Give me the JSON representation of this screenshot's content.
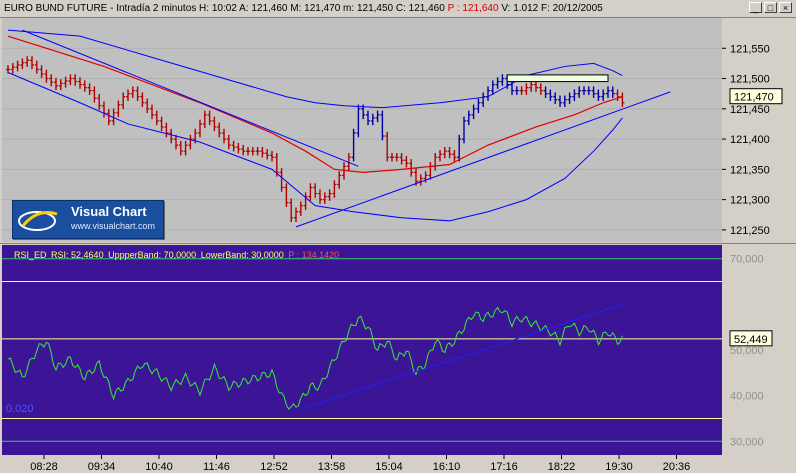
{
  "window": {
    "title": "EURO BUND FUTURE - Intradía 2 minutos",
    "high": "H: 10:02",
    "ohlc": "A: 121,460  M: 121,470  m: 121,450  C: 121,460",
    "p_value": "P : 121,640",
    "volume": "V: 1.012",
    "date": "F: 20/12/2005",
    "btn_minimize": "_",
    "btn_maximize": "□",
    "btn_close": "×"
  },
  "logo": {
    "title": "Visual Chart",
    "url": "www.visualchart.com"
  },
  "rsi_panel": {
    "header": [
      "RSI_ED",
      "RSI: 52,4640",
      "UppperBand: 70,0000",
      "LowerBand: 30,0000"
    ],
    "p_value": "P : 134,1420",
    "left_label": "0,020"
  },
  "colors": {
    "price_bg": "#c0c0c0",
    "rsi_bg": "#3c1496",
    "bar_red": "#b00000",
    "bar_blue": "#0000a0",
    "ma_line": "#e00000",
    "bands": "#0000ff",
    "rsi_line": "#33ee33",
    "guide_yellow": "#ffff99",
    "guide_green": "#33cc66"
  },
  "chart_data": [
    {
      "type": "ohlc",
      "title": "EURO BUND FUTURE",
      "x_ticks": [
        "08:28",
        "09:34",
        "10:40",
        "11:46",
        "12:52",
        "13:58",
        "15:04",
        "16:10",
        "17:16",
        "18:22",
        "19:30",
        "20:36"
      ],
      "y_ticks": [
        "121,550",
        "121,500",
        "121,450",
        "121,400",
        "121,350",
        "121,300",
        "121,250"
      ],
      "ylim": [
        121.23,
        121.6
      ],
      "last_value": "121,470",
      "close_series": [
        {
          "t": 0,
          "v": 121.515
        },
        {
          "t": 4,
          "v": 121.53
        },
        {
          "t": 8,
          "v": 121.5
        },
        {
          "t": 10,
          "v": 121.488
        },
        {
          "t": 13,
          "v": 121.5
        },
        {
          "t": 17,
          "v": 121.48
        },
        {
          "t": 19,
          "v": 121.455
        },
        {
          "t": 21,
          "v": 121.43
        },
        {
          "t": 24,
          "v": 121.47
        },
        {
          "t": 26,
          "v": 121.48
        },
        {
          "t": 28,
          "v": 121.46
        },
        {
          "t": 31,
          "v": 121.43
        },
        {
          "t": 34,
          "v": 121.4
        },
        {
          "t": 36,
          "v": 121.38
        },
        {
          "t": 39,
          "v": 121.41
        },
        {
          "t": 41,
          "v": 121.44
        },
        {
          "t": 43,
          "v": 121.42
        },
        {
          "t": 46,
          "v": 121.39
        },
        {
          "t": 49,
          "v": 121.38
        },
        {
          "t": 52,
          "v": 121.38
        },
        {
          "t": 55,
          "v": 121.37
        },
        {
          "t": 57,
          "v": 121.32
        },
        {
          "t": 59,
          "v": 121.27
        },
        {
          "t": 61,
          "v": 121.29
        },
        {
          "t": 63,
          "v": 121.32
        },
        {
          "t": 65,
          "v": 121.3
        },
        {
          "t": 67,
          "v": 121.31
        },
        {
          "t": 69,
          "v": 121.34
        },
        {
          "t": 71,
          "v": 121.37
        },
        {
          "t": 73,
          "v": 121.45
        },
        {
          "t": 75,
          "v": 121.43
        },
        {
          "t": 77,
          "v": 121.44
        },
        {
          "t": 79,
          "v": 121.37
        },
        {
          "t": 81,
          "v": 121.37
        },
        {
          "t": 83,
          "v": 121.36
        },
        {
          "t": 85,
          "v": 121.33
        },
        {
          "t": 87,
          "v": 121.34
        },
        {
          "t": 89,
          "v": 121.37
        },
        {
          "t": 91,
          "v": 121.38
        },
        {
          "t": 93,
          "v": 121.37
        },
        {
          "t": 95,
          "v": 121.43
        },
        {
          "t": 97,
          "v": 121.45
        },
        {
          "t": 99,
          "v": 121.47
        },
        {
          "t": 101,
          "v": 121.49
        },
        {
          "t": 103,
          "v": 121.5
        },
        {
          "t": 105,
          "v": 121.48
        },
        {
          "t": 107,
          "v": 121.48
        },
        {
          "t": 109,
          "v": 121.49
        },
        {
          "t": 111,
          "v": 121.48
        },
        {
          "t": 113,
          "v": 121.47
        },
        {
          "t": 115,
          "v": 121.46
        },
        {
          "t": 117,
          "v": 121.47
        },
        {
          "t": 119,
          "v": 121.48
        },
        {
          "t": 121,
          "v": 121.48
        },
        {
          "t": 123,
          "v": 121.47
        },
        {
          "t": 125,
          "v": 121.48
        },
        {
          "t": 127,
          "v": 121.47
        },
        {
          "t": 128,
          "v": 121.46
        }
      ],
      "moving_average": [
        {
          "t": 0,
          "v": 121.57
        },
        {
          "t": 20,
          "v": 121.52
        },
        {
          "t": 40,
          "v": 121.46
        },
        {
          "t": 55,
          "v": 121.41
        },
        {
          "t": 62,
          "v": 121.38
        },
        {
          "t": 68,
          "v": 121.35
        },
        {
          "t": 74,
          "v": 121.345
        },
        {
          "t": 82,
          "v": 121.35
        },
        {
          "t": 92,
          "v": 121.358
        },
        {
          "t": 100,
          "v": 121.39
        },
        {
          "t": 110,
          "v": 121.42
        },
        {
          "t": 118,
          "v": 121.44
        },
        {
          "t": 124,
          "v": 121.46
        },
        {
          "t": 128,
          "v": 121.47
        }
      ],
      "upper_band": [
        {
          "t": 0,
          "v": 121.58
        },
        {
          "t": 15,
          "v": 121.57
        },
        {
          "t": 30,
          "v": 121.535
        },
        {
          "t": 45,
          "v": 121.5
        },
        {
          "t": 58,
          "v": 121.47
        },
        {
          "t": 64,
          "v": 121.46
        },
        {
          "t": 70,
          "v": 121.455
        },
        {
          "t": 78,
          "v": 121.452
        },
        {
          "t": 90,
          "v": 121.46
        },
        {
          "t": 100,
          "v": 121.47
        },
        {
          "t": 108,
          "v": 121.505
        },
        {
          "t": 116,
          "v": 121.52
        },
        {
          "t": 122,
          "v": 121.525
        },
        {
          "t": 126,
          "v": 121.513
        },
        {
          "t": 128,
          "v": 121.505
        }
      ],
      "lower_band": [
        {
          "t": 0,
          "v": 121.51
        },
        {
          "t": 15,
          "v": 121.46
        },
        {
          "t": 25,
          "v": 121.425
        },
        {
          "t": 40,
          "v": 121.395
        },
        {
          "t": 55,
          "v": 121.35
        },
        {
          "t": 64,
          "v": 121.29
        },
        {
          "t": 72,
          "v": 121.28
        },
        {
          "t": 82,
          "v": 121.27
        },
        {
          "t": 92,
          "v": 121.265
        },
        {
          "t": 100,
          "v": 121.28
        },
        {
          "t": 108,
          "v": 121.3
        },
        {
          "t": 116,
          "v": 121.335
        },
        {
          "t": 122,
          "v": 121.38
        },
        {
          "t": 126,
          "v": 121.415
        },
        {
          "t": 128,
          "v": 121.435
        }
      ],
      "trendlines": [
        {
          "from": {
            "t": 3,
            "v": 121.58
          },
          "to": {
            "t": 73,
            "v": 121.355
          }
        },
        {
          "from": {
            "t": 60,
            "v": 121.255
          },
          "to": {
            "t": 138,
            "v": 121.478
          }
        }
      ],
      "resistance_box": {
        "from": {
          "t": 104,
          "v": 121.506
        },
        "to": {
          "t": 125,
          "v": 121.495
        }
      }
    },
    {
      "type": "line",
      "title": "RSI_ED",
      "y_ticks": [
        "70,000",
        "50,000",
        "40,000",
        "30,000"
      ],
      "ylim": [
        27,
        73
      ],
      "last_value": "52,449",
      "guides": [
        {
          "v": 70,
          "color": "green"
        },
        {
          "v": 65,
          "color": "yellow"
        },
        {
          "v": 52.449,
          "color": "yellow"
        },
        {
          "v": 35,
          "color": "yellow"
        },
        {
          "v": 30,
          "color": "green"
        }
      ],
      "series": [
        {
          "values": [
            {
              "t": 0,
              "v": 48
            },
            {
              "t": 3,
              "v": 44
            },
            {
              "t": 6,
              "v": 50
            },
            {
              "t": 8,
              "v": 52
            },
            {
              "t": 10,
              "v": 46
            },
            {
              "t": 13,
              "v": 48
            },
            {
              "t": 16,
              "v": 44
            },
            {
              "t": 19,
              "v": 47
            },
            {
              "t": 22,
              "v": 40
            },
            {
              "t": 25,
              "v": 43
            },
            {
              "t": 28,
              "v": 47
            },
            {
              "t": 31,
              "v": 45
            },
            {
              "t": 34,
              "v": 42
            },
            {
              "t": 37,
              "v": 44
            },
            {
              "t": 40,
              "v": 41
            },
            {
              "t": 43,
              "v": 46
            },
            {
              "t": 46,
              "v": 42
            },
            {
              "t": 49,
              "v": 43
            },
            {
              "t": 52,
              "v": 44
            },
            {
              "t": 55,
              "v": 45
            },
            {
              "t": 57,
              "v": 40
            },
            {
              "t": 59,
              "v": 37
            },
            {
              "t": 61,
              "v": 39
            },
            {
              "t": 63,
              "v": 42
            },
            {
              "t": 65,
              "v": 42
            },
            {
              "t": 67,
              "v": 46
            },
            {
              "t": 69,
              "v": 50
            },
            {
              "t": 71,
              "v": 54
            },
            {
              "t": 73,
              "v": 57
            },
            {
              "t": 75,
              "v": 55
            },
            {
              "t": 77,
              "v": 50
            },
            {
              "t": 79,
              "v": 52
            },
            {
              "t": 81,
              "v": 48
            },
            {
              "t": 83,
              "v": 50
            },
            {
              "t": 85,
              "v": 45
            },
            {
              "t": 87,
              "v": 47
            },
            {
              "t": 89,
              "v": 52
            },
            {
              "t": 91,
              "v": 50
            },
            {
              "t": 93,
              "v": 52
            },
            {
              "t": 95,
              "v": 55
            },
            {
              "t": 97,
              "v": 58
            },
            {
              "t": 99,
              "v": 57
            },
            {
              "t": 101,
              "v": 58
            },
            {
              "t": 103,
              "v": 59
            },
            {
              "t": 105,
              "v": 56
            },
            {
              "t": 107,
              "v": 57
            },
            {
              "t": 109,
              "v": 56
            },
            {
              "t": 111,
              "v": 55
            },
            {
              "t": 113,
              "v": 54
            },
            {
              "t": 115,
              "v": 52
            },
            {
              "t": 117,
              "v": 56
            },
            {
              "t": 119,
              "v": 54
            },
            {
              "t": 121,
              "v": 55
            },
            {
              "t": 123,
              "v": 52
            },
            {
              "t": 125,
              "v": 54
            },
            {
              "t": 127,
              "v": 52
            },
            {
              "t": 128,
              "v": 52.4
            }
          ]
        }
      ],
      "trendline": {
        "from": {
          "t": 61,
          "v": 37
        },
        "to": {
          "t": 128,
          "v": 60
        }
      }
    }
  ]
}
